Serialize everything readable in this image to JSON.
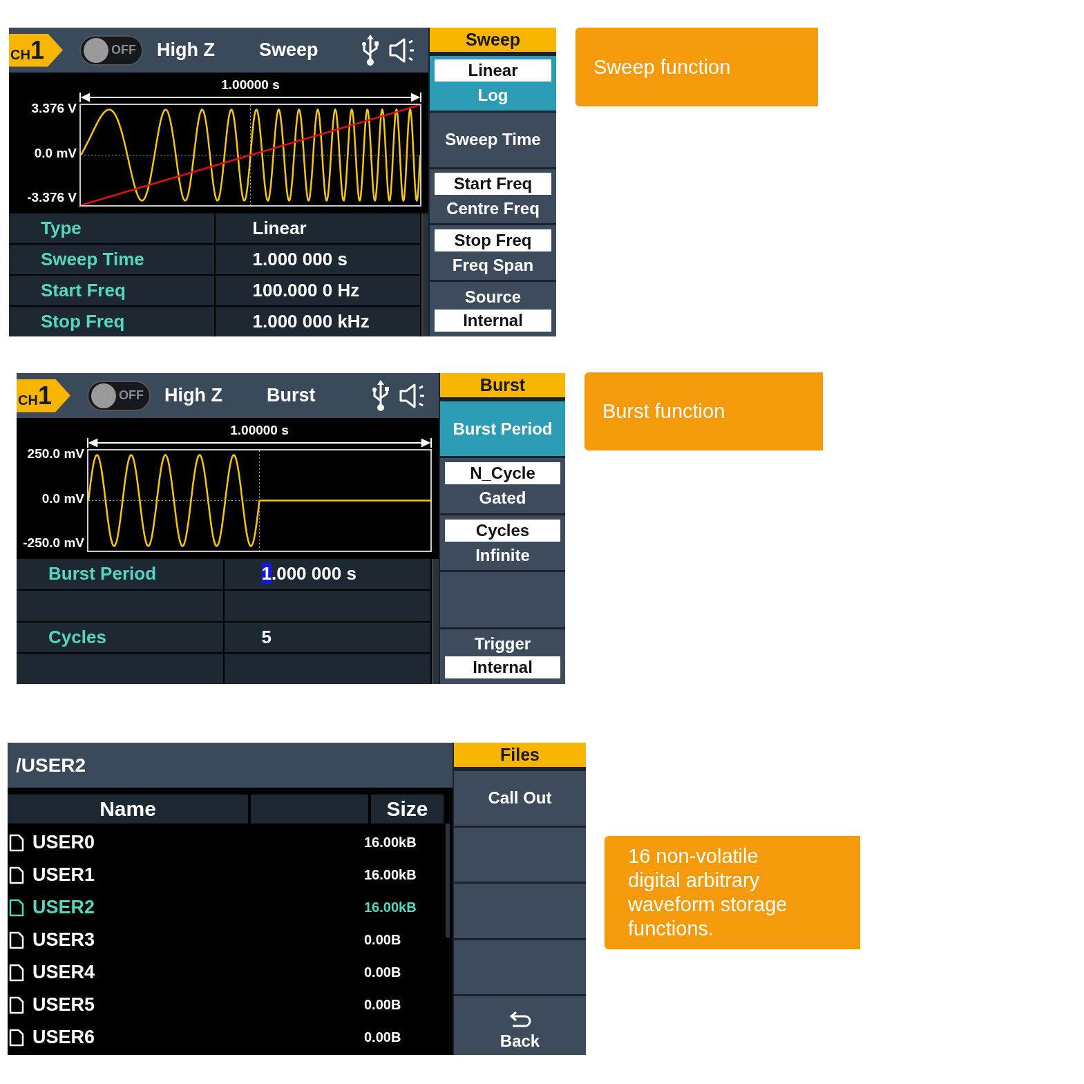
{
  "screens": [
    {
      "kind": "waveform",
      "channel": {
        "prefix": "CH",
        "number": "1"
      },
      "output": {
        "on": false,
        "label": "OFF"
      },
      "load": "High Z",
      "mode": "Sweep",
      "plot": {
        "kind": "sweep",
        "span": "1.00000 s",
        "y_labels": [
          "3.376 V",
          "0.0 mV",
          "-3.376 V"
        ]
      },
      "params": [
        {
          "kind": "param",
          "label": "Type",
          "value": "Linear",
          "cursor": false
        },
        {
          "kind": "param",
          "label": "Sweep Time",
          "value": "1.000 000 s",
          "cursor": false
        },
        {
          "kind": "param",
          "label": "Start Freq",
          "value": "100.000 0 Hz",
          "cursor": false
        },
        {
          "kind": "param",
          "label": "Stop Freq",
          "value": "1.000 000 kHz",
          "cursor": false
        }
      ],
      "menu": {
        "title": "Sweep",
        "keys": [
          {
            "kind": "choice",
            "highlighted": true,
            "options": [
              {
                "label": "Linear",
                "selected": true
              },
              {
                "label": "Log",
                "selected": false
              }
            ]
          },
          {
            "kind": "label",
            "highlighted": false,
            "label": "Sweep Time"
          },
          {
            "kind": "choice",
            "highlighted": false,
            "options": [
              {
                "label": "Start Freq",
                "selected": true
              },
              {
                "label": "Centre Freq",
                "selected": false
              }
            ]
          },
          {
            "kind": "choice",
            "highlighted": false,
            "options": [
              {
                "label": "Stop Freq",
                "selected": true
              },
              {
                "label": "Freq Span",
                "selected": false
              }
            ]
          },
          {
            "kind": "pair",
            "highlighted": false,
            "label": "Source",
            "value": "Internal"
          }
        ]
      },
      "callout": "Sweep function"
    },
    {
      "kind": "waveform",
      "channel": {
        "prefix": "CH",
        "number": "1"
      },
      "output": {
        "on": false,
        "label": "OFF"
      },
      "load": "High Z",
      "mode": "Burst",
      "plot": {
        "kind": "burst",
        "span": "1.00000 s",
        "y_labels": [
          "250.0 mV",
          "0.0 mV",
          "-250.0 mV"
        ]
      },
      "params": [
        {
          "kind": "param",
          "label": "Burst Period",
          "value": "1.000 000 s",
          "cursor": true
        },
        {
          "kind": "blank"
        },
        {
          "kind": "param",
          "label": "Cycles",
          "value": "5",
          "cursor": false
        },
        {
          "kind": "blank"
        }
      ],
      "menu": {
        "title": "Burst",
        "keys": [
          {
            "kind": "label",
            "highlighted": true,
            "label": "Burst Period"
          },
          {
            "kind": "choice",
            "highlighted": false,
            "options": [
              {
                "label": "N_Cycle",
                "selected": true
              },
              {
                "label": "Gated",
                "selected": false
              }
            ]
          },
          {
            "kind": "choice",
            "highlighted": false,
            "options": [
              {
                "label": "Cycles",
                "selected": true
              },
              {
                "label": "Infinite",
                "selected": false
              }
            ]
          },
          {
            "kind": "blank",
            "highlighted": false
          },
          {
            "kind": "pair",
            "highlighted": false,
            "label": "Trigger",
            "value": "Internal"
          }
        ]
      },
      "callout": "Burst function"
    },
    {
      "kind": "files",
      "path": "/USER2",
      "columns": [
        {
          "kind": "text",
          "label": "Name"
        },
        {
          "kind": "blank"
        },
        {
          "kind": "text",
          "label": "Size"
        }
      ],
      "files": [
        {
          "name": "USER0",
          "size": "16.00kB",
          "selected": false
        },
        {
          "name": "USER1",
          "size": "16.00kB",
          "selected": false
        },
        {
          "name": "USER2",
          "size": "16.00kB",
          "selected": true
        },
        {
          "name": "USER3",
          "size": "0.00B",
          "selected": false
        },
        {
          "name": "USER4",
          "size": "0.00B",
          "selected": false
        },
        {
          "name": "USER5",
          "size": "0.00B",
          "selected": false
        },
        {
          "name": "USER6",
          "size": "0.00B",
          "selected": false
        }
      ],
      "menu": {
        "title": "Files",
        "keys": [
          {
            "kind": "label",
            "highlighted": false,
            "label": "Call Out"
          },
          {
            "kind": "blank",
            "highlighted": false
          },
          {
            "kind": "blank",
            "highlighted": false
          },
          {
            "kind": "blank",
            "highlighted": false
          },
          {
            "kind": "back",
            "highlighted": false,
            "label": "Back"
          }
        ]
      },
      "callout": "16 non-volatile digital arbitrary waveform storage functions."
    }
  ]
}
